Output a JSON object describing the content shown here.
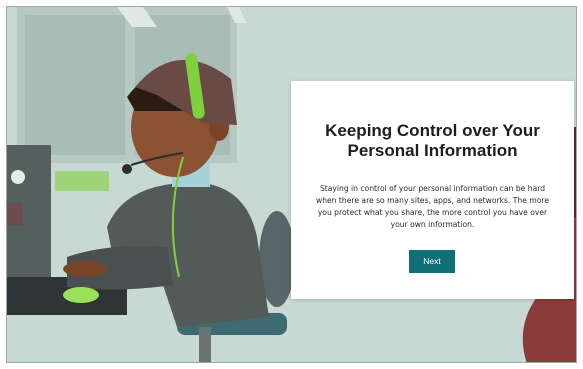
{
  "dialog": {
    "title": "Keeping Control over Your Personal Information",
    "body": "Staying in control of your personal information can be hard when there are so many sites, apps, and networks. The more you protect what you share, the more control you have over your own information.",
    "next_label": "Next"
  },
  "colors": {
    "background": "#c8d8d2",
    "button": "#126f79",
    "headband": "#7fd13b"
  },
  "illustration": {
    "subject": "person-with-headset-at-computer"
  }
}
